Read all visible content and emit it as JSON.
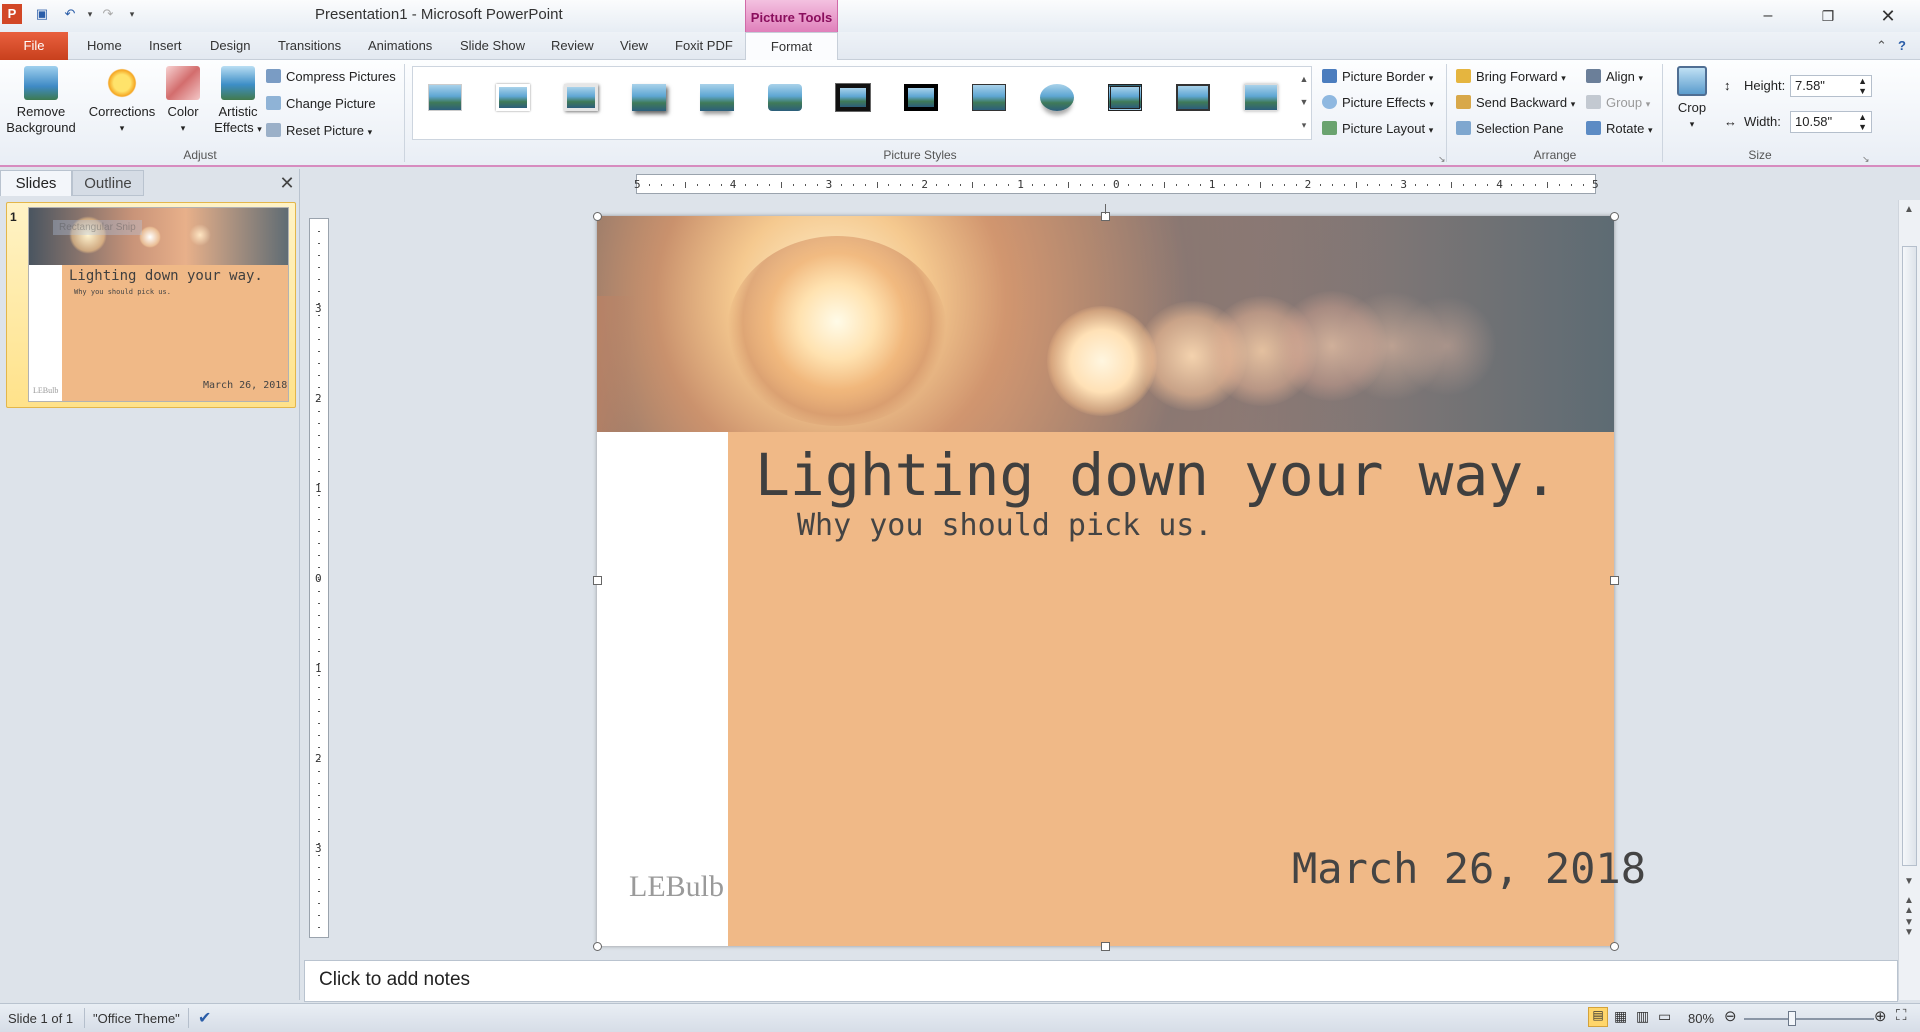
{
  "window": {
    "title": "Presentation1  -  Microsoft PowerPoint",
    "contextual_tab_header": "Picture Tools",
    "minimize_icon": "minimize-icon",
    "restore_icon": "restore-icon",
    "close_icon": "close-icon"
  },
  "tabs": {
    "file": "File",
    "home": "Home",
    "insert": "Insert",
    "design": "Design",
    "transitions": "Transitions",
    "animations": "Animations",
    "slideshow": "Slide Show",
    "review": "Review",
    "view": "View",
    "foxit": "Foxit PDF",
    "format": "Format"
  },
  "ribbon": {
    "adjust": {
      "label": "Adjust",
      "remove_background": "Remove Background",
      "remove_background_l1": "Remove",
      "remove_background_l2": "Background",
      "corrections": "Corrections",
      "color": "Color",
      "artistic_l1": "Artistic",
      "artistic_l2": "Effects",
      "compress": "Compress Pictures",
      "change": "Change Picture",
      "reset": "Reset Picture"
    },
    "picture_styles": {
      "label": "Picture Styles",
      "border": "Picture Border",
      "effects": "Picture Effects",
      "layout": "Picture Layout"
    },
    "arrange": {
      "label": "Arrange",
      "bring_forward": "Bring Forward",
      "send_backward": "Send Backward",
      "selection_pane": "Selection Pane",
      "align": "Align",
      "group": "Group",
      "rotate": "Rotate"
    },
    "size": {
      "label": "Size",
      "crop": "Crop",
      "height_label": "Height:",
      "height_value": "7.58\"",
      "width_label": "Width:",
      "width_value": "10.58\""
    }
  },
  "left_pane": {
    "slides_tab": "Slides",
    "outline_tab": "Outline",
    "slide_number": "1",
    "tooltip_ghost": "Rectangular Snip"
  },
  "slide": {
    "title": "Lighting down your way.",
    "subtitle": "Why you should pick us.",
    "date": "March 26, 2018",
    "logo": "LEBulb"
  },
  "notes": {
    "placeholder": "Click to add notes"
  },
  "ruler": {
    "h_labels": [
      "5",
      "4",
      "3",
      "2",
      "1",
      "0",
      "1",
      "2",
      "3",
      "4",
      "5"
    ],
    "v_labels": [
      "3",
      "2",
      "1",
      "0",
      "1",
      "2",
      "3"
    ]
  },
  "statusbar": {
    "slide_info": "Slide 1 of 1",
    "theme": "\"Office Theme\"",
    "zoom": "80%"
  },
  "colors": {
    "accent_file": "#d24726",
    "picture_tools": "#e080bb",
    "slide_orange": "#f0b987"
  }
}
